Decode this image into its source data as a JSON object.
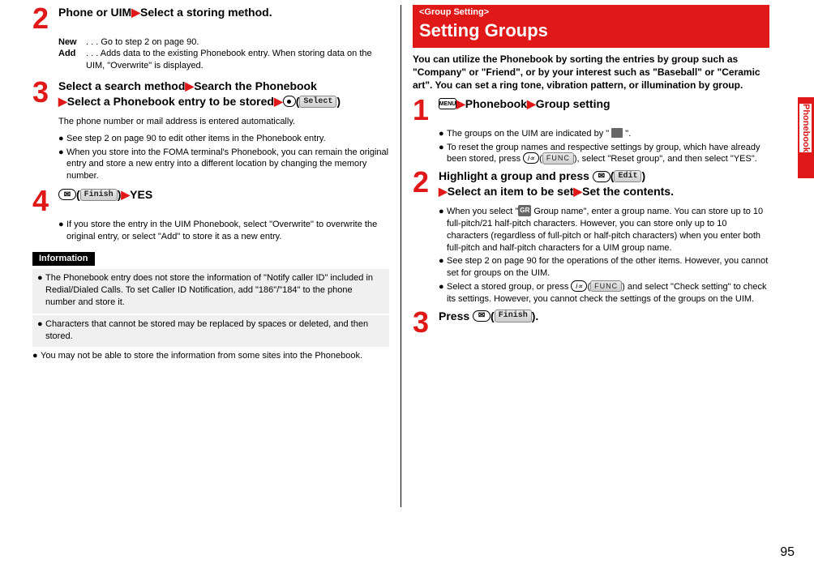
{
  "side_tab_label": "Phonebook",
  "page_number": "95",
  "left": {
    "step2": {
      "title_a": "Phone or UIM",
      "title_b": "Select a storing method.",
      "new_term": "New",
      "new_desc": " . . . Go to step 2 on page 90.",
      "add_term": "Add",
      "add_desc": " . . . Adds data to the existing Phonebook entry. When storing data on the UIM, \"Overwrite\" is displayed."
    },
    "step3": {
      "title_a": "Select a search method",
      "title_b": "Search the Phonebook",
      "title_c": "Select a Phonebook entry to be stored",
      "select_label": "Select",
      "body1": "The phone number or mail address is entered automatically.",
      "b1": "See step 2 on page 90 to edit other items in the Phonebook entry.",
      "b2": "When you store into the FOMA terminal's Phonebook, you can remain the original entry and store a new entry into a different location by changing the memory number."
    },
    "step4": {
      "finish_label": "Finish",
      "yes": "YES",
      "b1": "If you store the entry in the UIM Phonebook, select \"Overwrite\" to overwrite the original entry, or select \"Add\" to store it as a new entry."
    },
    "info_hdr": "Information",
    "info": {
      "i1": "The Phonebook entry does not store the information of \"Notify caller ID\" included in Redial/Dialed Calls. To set Caller ID Notification, add \"186\"/\"184\" to the phone number and store it.",
      "i2": "Characters that cannot be stored may be replaced by spaces or deleted, and then stored.",
      "i3": "You may not be able to store the information from some sites into the Phonebook."
    }
  },
  "right": {
    "heading_sub": "<Group Setting>",
    "heading_main": "Setting Groups",
    "intro": "You can utilize the Phonebook by sorting the entries by group such as \"Company\" or \"Friend\", or by your interest such as \"Baseball\" or \"Ceramic art\". You can set a ring tone, vibration pattern, or illumination by group.",
    "step1": {
      "menu": "MENU",
      "pb": "Phonebook",
      "gs": "Group setting",
      "b1_a": "The groups on the UIM are indicated by \" ",
      "b1_b": " \".",
      "b2_a": "To reset the group names and respective settings by group, which have already been stored, press ",
      "b2_b": "), select \"Reset group\", and then select \"YES\".",
      "func": "FUNC"
    },
    "step2": {
      "title_a": "Highlight a group and press ",
      "edit_label": "Edit",
      "title_b": "Select an item to be set",
      "title_c": "Set the contents.",
      "b1_a": "When you select \"",
      "b1_b": " Group name\", enter a group name. You can store up to 10 full-pitch/21 half-pitch characters. However, you can store only up to 10 characters (regardless of full-pitch or half-pitch characters) when you enter both full-pitch and half-pitch characters for a UIM group name.",
      "b2": "See step 2 on page 90 for the operations of the other items. However, you cannot set for groups on the UIM.",
      "b3_a": "Select a stored group, or press ",
      "b3_b": ") and select \"Check setting\" to check its settings. However, you cannot check the settings of the groups on the UIM.",
      "func": "FUNC"
    },
    "step3": {
      "title_a": "Press ",
      "finish_label": "Finish",
      "title_b": ")."
    }
  }
}
